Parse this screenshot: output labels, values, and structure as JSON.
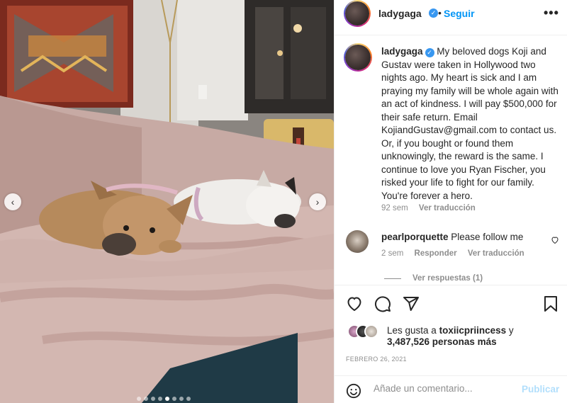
{
  "header": {
    "username": "ladygaga",
    "verified_icon": "verified-badge-icon",
    "dot": "•",
    "follow_label": "Seguir",
    "more_icon": "more-options-icon",
    "more_label": "•••"
  },
  "caption": {
    "username": "ladygaga",
    "text": "My beloved dogs Koji and Gustav were taken in Hollywood two nights ago. My heart is sick and I am praying my family will be whole again with an act of kindness. I will pay $500,000 for their safe return. Email KojiandGustav@gmail.com to contact us. Or, if you bought or found them unknowingly, the reward is the same. I continue to love you Ryan Fischer, you risked your life to fight for our family. You're forever a hero.",
    "time": "92 sem",
    "translate_label": "Ver traducción"
  },
  "comment": {
    "username": "pearlporquette",
    "text": "Please follow me",
    "time": "2 sem",
    "reply_label": "Responder",
    "translate_label": "Ver traducción",
    "view_replies_label": "Ver respuestas (1)"
  },
  "actions": {
    "like_icon": "heart-icon",
    "comment_icon": "comment-icon",
    "share_icon": "share-icon",
    "save_icon": "bookmark-icon"
  },
  "likes": {
    "prefix": "Les gusta a",
    "first_user": "toxiicpriincess",
    "conjunction": "y",
    "count_text": "3,487,526 personas más"
  },
  "date": "FEBRERO 26, 2021",
  "comment_box": {
    "placeholder": "Añade un comentario...",
    "publish_label": "Publicar",
    "emoji_icon": "emoji-icon"
  },
  "carousel": {
    "prev_label": "‹",
    "next_label": "›",
    "dot_count": 8,
    "active_dot": 4
  },
  "colors": {
    "accent": "#0095f6",
    "publish_disabled": "#b2dffc",
    "muted": "#8e8e8e",
    "verified": "#3897f0"
  }
}
